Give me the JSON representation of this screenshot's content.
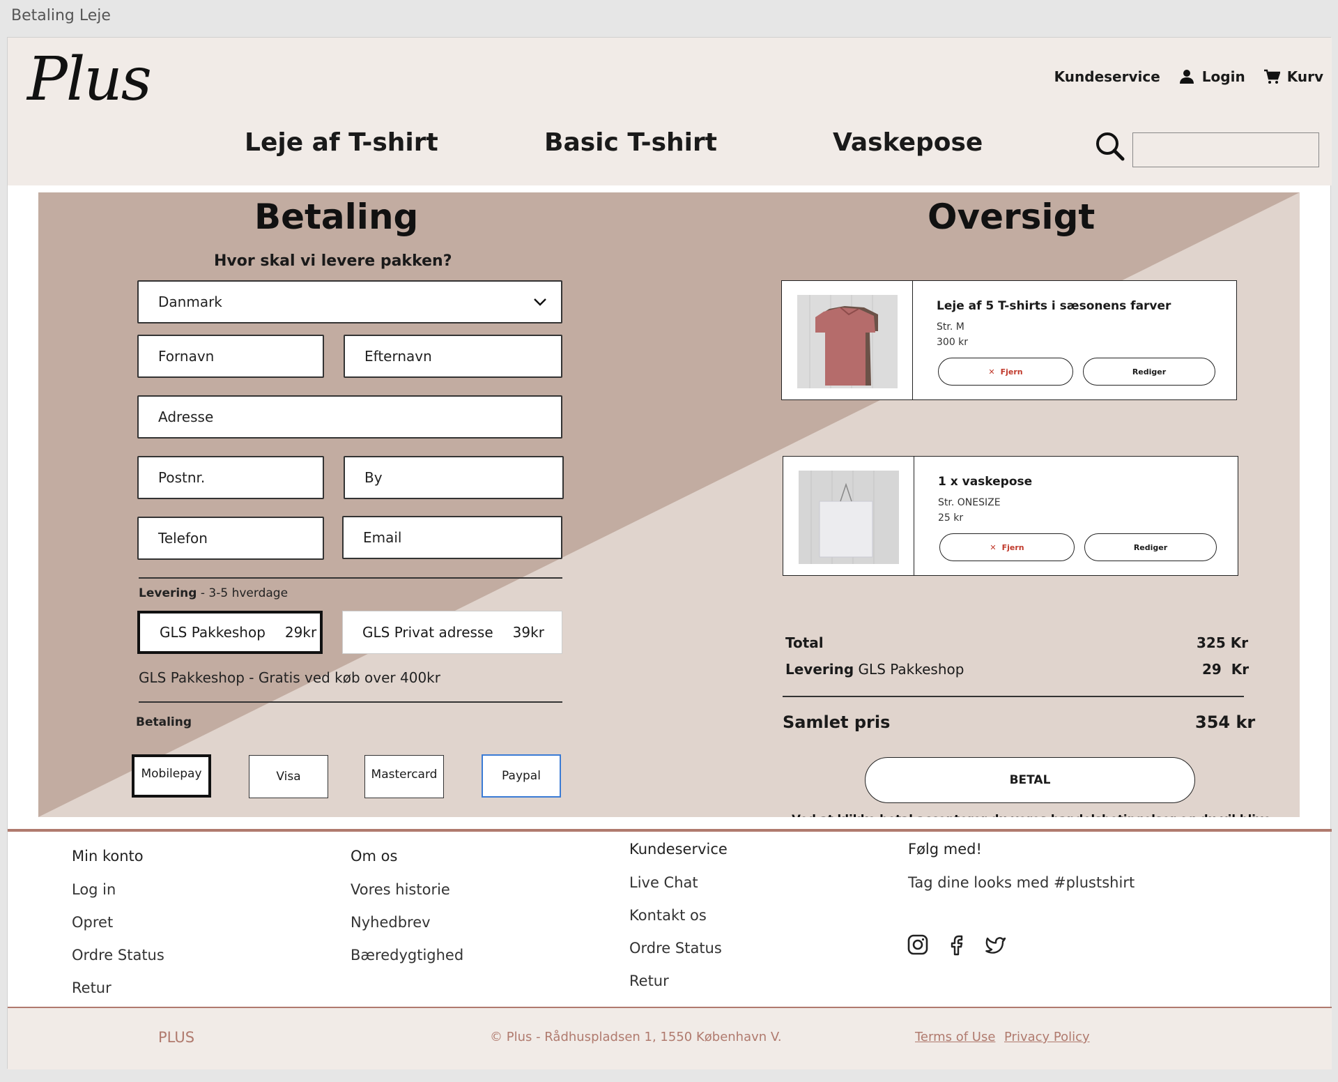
{
  "window": {
    "title": "Betaling Leje"
  },
  "header": {
    "logo": "Plus",
    "util": {
      "customer_service": "Kundeservice",
      "login": "Login",
      "cart": "Kurv"
    },
    "nav": [
      "Leje af T-shirt",
      "Basic T-shirt",
      "Vaskepose"
    ],
    "search_placeholder": ""
  },
  "checkout": {
    "payment_title": "Betaling",
    "overview_title": "Oversigt",
    "question": "Hvor skal vi levere pakken?",
    "country": "Danmark",
    "fields": {
      "first_name": "Fornavn",
      "last_name": "Efternavn",
      "address": "Adresse",
      "zip": "Postnr.",
      "city": "By",
      "phone": "Telefon",
      "email": "Email"
    },
    "delivery_label": "Levering",
    "delivery_time": " - 3-5 hverdage",
    "shipping_options": [
      {
        "name": "GLS Pakkeshop",
        "price": "29kr",
        "selected": true
      },
      {
        "name": "GLS Privat adresse",
        "price": "39kr",
        "selected": false
      }
    ],
    "shipping_note": "GLS Pakkeshop -  Gratis ved køb over 400kr",
    "payment_label": "Betaling",
    "payment_methods": [
      "Mobilepay",
      "Visa",
      "Mastercard",
      "Paypal"
    ],
    "selected_payment": "Mobilepay"
  },
  "cart": {
    "items": [
      {
        "title": "Leje af 5 T-shirts i sæsonens farver",
        "size": "Str. M",
        "price": "300 kr",
        "remove": "Fjern",
        "edit": "Rediger"
      },
      {
        "title": "1 x vaskepose",
        "size": "Str. ONESIZE",
        "price": "25 kr",
        "remove": "Fjern",
        "edit": "Rediger"
      }
    ],
    "total_label": "Total",
    "total_value": "325 Kr",
    "delivery_label": "Levering",
    "delivery_method": "GLS Pakkeshop",
    "delivery_value": "29  Kr",
    "grand_label": "Samlet pris",
    "grand_value": "354 kr",
    "pay_button": "BETAL",
    "disclaimer": "Ved at klikke betal accepterer du vores handelsbetingelser og du vil blive taget videre til en krypteret godkendt forbindelse"
  },
  "footer": {
    "columns": [
      {
        "heading": "Min konto",
        "links": [
          "Log in",
          "Opret",
          "Ordre Status",
          "Retur"
        ]
      },
      {
        "heading": "Om os",
        "links": [
          "Vores historie",
          "Nyhedbrev",
          "Bæredygtighed"
        ]
      },
      {
        "heading": "Kundeservice",
        "links": [
          "Live Chat",
          "Kontakt os",
          "Ordre Status",
          "Retur"
        ]
      },
      {
        "heading": "Følg med!",
        "links": [
          "Tag dine looks med #plustshirt"
        ]
      }
    ],
    "social": [
      "instagram-icon",
      "facebook-icon",
      "twitter-icon"
    ],
    "brand": "PLUS",
    "copyright": "© Plus - Rådhuspladsen 1, 1550 København V.",
    "terms": "Terms of Use",
    "privacy": "Privacy Policy"
  },
  "colors": {
    "accent": "#c2aca1",
    "accent_light": "#e0d4cd",
    "header_bg": "#f1ebe7",
    "footer_accent": "#b07a6e",
    "paypal_blue": "#3a7bd5"
  }
}
